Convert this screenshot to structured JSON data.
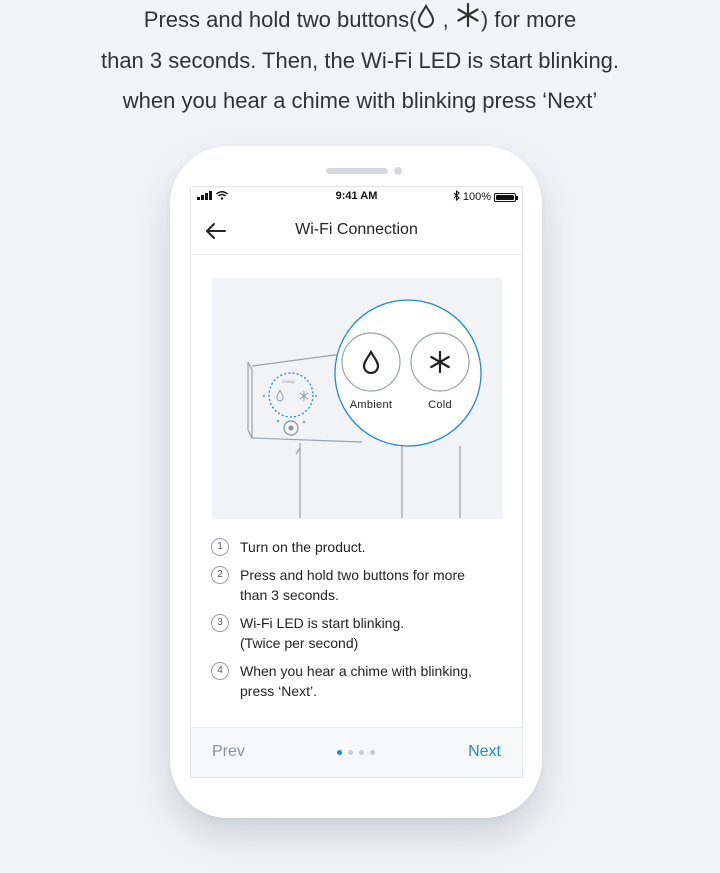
{
  "caption": {
    "line1_pre": "Press and hold two buttons(",
    "line1_sep": ",",
    "line1_post": ") for more",
    "line2": "than 3 seconds. Then, the Wi-Fi LED is start blinking.",
    "line3": "when you hear a chime with blinking press ‘Next’"
  },
  "status_bar": {
    "time": "9:41 AM",
    "battery_text": "100%",
    "battery_level": 1.0
  },
  "header": {
    "title": "Wi-Fi Connection",
    "back_icon": "arrow-left-icon"
  },
  "illustration": {
    "ambient_label": "Ambient",
    "cold_label": "Cold",
    "ambient_icon": "water-drop-icon",
    "cold_icon": "snowflake-asterisk-icon",
    "accent_color": "#1f8ad8"
  },
  "steps": [
    {
      "number": "1",
      "lines": [
        "Turn on the product."
      ]
    },
    {
      "number": "2",
      "lines": [
        "Press and hold two buttons for more",
        "than 3 seconds."
      ]
    },
    {
      "number": "3",
      "lines": [
        "Wi-Fi LED is start blinking.",
        "(Twice per second)"
      ]
    },
    {
      "number": "4",
      "lines": [
        "When you hear a chime with blinking,",
        "press ‘Next’."
      ]
    }
  ],
  "footer": {
    "prev_label": "Prev",
    "next_label": "Next",
    "page_count": 4,
    "current_page": 1
  },
  "colors": {
    "accent": "#1f8ad8",
    "background": "#f3f4f8"
  }
}
